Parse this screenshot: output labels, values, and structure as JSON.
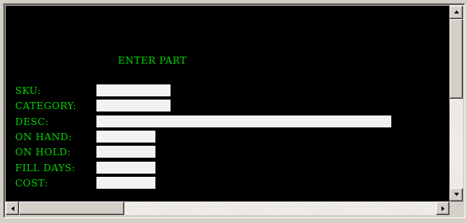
{
  "terminal": {
    "heading": "ENTER PART",
    "text_color": "#00d800",
    "background": "#000000"
  },
  "form": {
    "sku": {
      "label": "SKU:",
      "value": ""
    },
    "category": {
      "label": "CATEGORY:",
      "value": ""
    },
    "desc": {
      "label": "DESC:",
      "value": ""
    },
    "on_hand": {
      "label": "ON HAND:",
      "value": ""
    },
    "on_hold": {
      "label": "ON HOLD:",
      "value": ""
    },
    "fill_days": {
      "label": "FILL DAYS:",
      "value": ""
    },
    "cost": {
      "label": "COST:",
      "value": ""
    }
  },
  "scrollbars": {
    "vertical": {
      "up_icon": "arrow-up-icon",
      "down_icon": "arrow-down-icon",
      "position": 0
    },
    "horizontal": {
      "left_icon": "arrow-left-icon",
      "right_icon": "arrow-right-icon",
      "position": 0
    }
  }
}
